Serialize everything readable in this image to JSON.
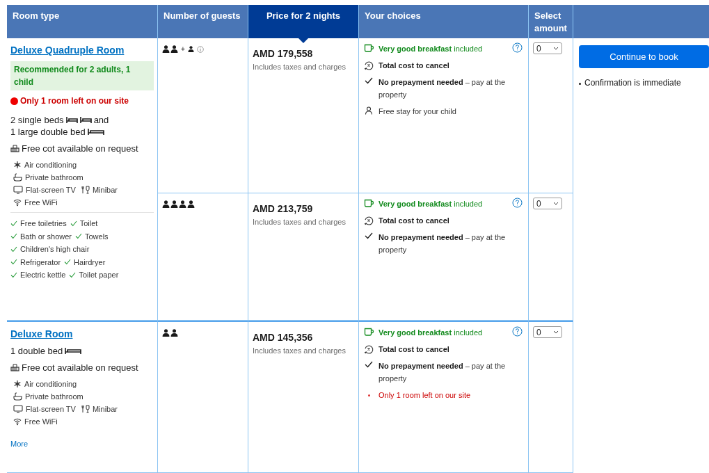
{
  "columns": [
    {
      "label": "Room type",
      "selected": false
    },
    {
      "label": "Number of guests",
      "selected": false
    },
    {
      "label": "Price for 2 nights",
      "selected": true
    },
    {
      "label": "Your choices",
      "selected": false
    },
    {
      "label": "Select amount",
      "selected": false
    }
  ],
  "rooms": [
    {
      "name": "Deluxe Quadruple Room",
      "recommendation": "Recommended for 2 adults, 1 child",
      "scarcity": "Only 1 room left on our site",
      "beds": [
        {
          "text": "2 single beds",
          "bed_icons": [
            {
              "kind": "single"
            },
            {
              "kind": "single"
            }
          ],
          "suffix": "and"
        },
        {
          "text": "1 large double bed",
          "bed_icons": [
            {
              "kind": "double"
            }
          ]
        }
      ],
      "cot": "Free cot available on request",
      "facility_rows": [
        {
          "items": [
            {
              "kind": "snowflake",
              "text": "Air conditioning"
            }
          ]
        },
        {
          "items": [
            {
              "kind": "bath",
              "text": "Private bathroom"
            }
          ]
        },
        {
          "items": [
            {
              "kind": "tv",
              "text": "Flat-screen TV"
            },
            {
              "kind": "minibar",
              "text": "Minibar"
            }
          ]
        },
        {
          "items": [
            {
              "kind": "wifi",
              "text": "Free WiFi"
            }
          ]
        }
      ],
      "amenity_rows": [
        {
          "items": [
            "Free toiletries",
            "Toilet"
          ]
        },
        {
          "items": [
            "Bath or shower",
            "Towels"
          ]
        },
        {
          "items": [
            "Children's high chair"
          ]
        },
        {
          "items": [
            "Refrigerator",
            "Hairdryer"
          ]
        },
        {
          "items": [
            "Electric kettle",
            "Toilet paper"
          ]
        }
      ],
      "options": [
        {
          "guests": [
            {
              "kind": "adult"
            },
            {
              "kind": "adult"
            },
            {
              "kind": "plus",
              "text": "+"
            },
            {
              "kind": "child"
            },
            {
              "kind": "info"
            }
          ],
          "price": "AMD 179,558",
          "price_note": "Includes taxes and charges",
          "amount": "0",
          "choices": [
            {
              "kind": "breakfast",
              "text": "**Very good breakfast** included"
            },
            {
              "kind": "cancel",
              "text": "Total cost to cancel"
            },
            {
              "kind": "prepay",
              "text": "**No prepayment needed** – pay at the property"
            },
            {
              "kind": "child",
              "text": "Free stay for your child"
            }
          ]
        },
        {
          "guests": [
            {
              "kind": "adult"
            },
            {
              "kind": "adult"
            },
            {
              "kind": "adult"
            },
            {
              "kind": "adult"
            }
          ],
          "price": "AMD 213,759",
          "price_note": "Includes taxes and charges",
          "amount": "0",
          "choices": [
            {
              "kind": "breakfast",
              "text": "**Very good breakfast** included"
            },
            {
              "kind": "cancel",
              "text": "Total cost to cancel"
            },
            {
              "kind": "prepay",
              "text": "**No prepayment needed** – pay at the property"
            }
          ]
        }
      ]
    },
    {
      "name": "Deluxe Room",
      "beds": [
        {
          "text": "1 double bed",
          "bed_icons": [
            {
              "kind": "double"
            }
          ]
        }
      ],
      "cot": "Free cot available on request",
      "facility_rows": [
        {
          "items": [
            {
              "kind": "snowflake",
              "text": "Air conditioning"
            }
          ]
        },
        {
          "items": [
            {
              "kind": "bath",
              "text": "Private bathroom"
            }
          ]
        },
        {
          "items": [
            {
              "kind": "tv",
              "text": "Flat-screen TV"
            },
            {
              "kind": "minibar",
              "text": "Minibar"
            }
          ]
        },
        {
          "items": [
            {
              "kind": "wifi",
              "text": "Free WiFi"
            }
          ]
        }
      ],
      "more": "More",
      "options": [
        {
          "guests": [
            {
              "kind": "adult"
            },
            {
              "kind": "adult"
            }
          ],
          "price": "AMD 145,356",
          "price_note": "Includes taxes and charges",
          "amount": "0",
          "choices": [
            {
              "kind": "breakfast",
              "text": "**Very good breakfast** included"
            },
            {
              "kind": "cancel",
              "text": "Total cost to cancel"
            },
            {
              "kind": "prepay",
              "text": "**No prepayment needed** – pay at the property"
            },
            {
              "kind": "scarcity",
              "text": "Only 1 room left on our site"
            }
          ]
        }
      ]
    }
  ],
  "booking": {
    "button": "Continue to book",
    "notes": [
      "Confirmation is immediate"
    ]
  }
}
